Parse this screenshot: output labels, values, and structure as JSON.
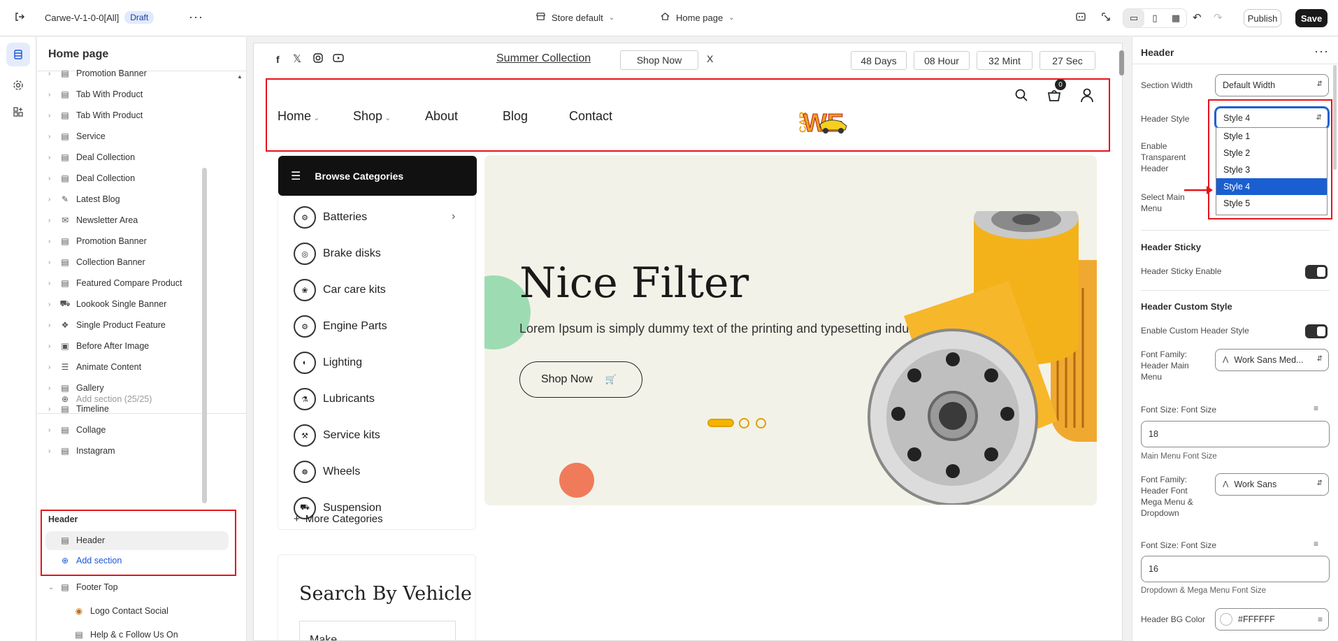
{
  "topbar": {
    "theme_name": "Carwe-V-1-0-0[All]",
    "status_badge": "Draft",
    "store_label": "Store default",
    "page_label": "Home page",
    "publish_label": "Publish",
    "save_label": "Save"
  },
  "sidebar": {
    "title": "Home page",
    "items": [
      {
        "label": "Promotion Banner",
        "icon": "section-icon"
      },
      {
        "label": "Tab With Product",
        "icon": "section-icon"
      },
      {
        "label": "Tab With Product",
        "icon": "section-icon"
      },
      {
        "label": "Service",
        "icon": "section-icon"
      },
      {
        "label": "Deal Collection",
        "icon": "section-icon"
      },
      {
        "label": "Deal Collection",
        "icon": "section-icon"
      },
      {
        "label": "Latest Blog",
        "icon": "blog-icon"
      },
      {
        "label": "Newsletter Area",
        "icon": "mail-icon"
      },
      {
        "label": "Promotion Banner",
        "icon": "section-icon"
      },
      {
        "label": "Collection Banner",
        "icon": "section-icon"
      },
      {
        "label": "Featured Compare Product",
        "icon": "section-icon"
      },
      {
        "label": "Lookook Single Banner",
        "icon": "truck-icon"
      },
      {
        "label": "Single Product Feature",
        "icon": "product-icon"
      },
      {
        "label": "Before After Image",
        "icon": "image-icon"
      },
      {
        "label": "Animate Content",
        "icon": "text-icon"
      },
      {
        "label": "Gallery",
        "icon": "section-icon"
      },
      {
        "label": "Timeline",
        "icon": "section-icon"
      },
      {
        "label": "Collage",
        "icon": "section-icon"
      },
      {
        "label": "Instagram",
        "icon": "section-icon"
      }
    ],
    "add_section_disabled": "Add section (25/25)",
    "header_group": {
      "title": "Header",
      "item": "Header",
      "add_section": "Add section"
    },
    "footer_top": "Footer Top",
    "logo_contact": "Logo Contact Social",
    "cut_row": "Help & c Follow Us On"
  },
  "preview": {
    "announcement": {
      "link": "Summer Collection",
      "shop_now": "Shop Now",
      "close": "X",
      "countdown": [
        "48 Days",
        "08 Hour",
        "32 Mint",
        "27 Sec"
      ]
    },
    "nav": [
      "Home",
      "Shop",
      "About",
      "Blog",
      "Contact"
    ],
    "logo_text": "CAR WE",
    "cart_count": "0",
    "browse_label": "Browse Categories",
    "categories": [
      "Batteries",
      "Brake disks",
      "Car care kits",
      "Engine Parts",
      "Lighting",
      "Lubricants",
      "Service kits",
      "Wheels",
      "Suspension"
    ],
    "more_categories": "More Categories",
    "hero": {
      "title": "Nice Filter",
      "subtitle": "Lorem Ipsum is simply dummy text of the printing and typesetting industry.",
      "button": "Shop Now"
    },
    "search_title": "Search By Vehicle",
    "make_label": "Make"
  },
  "settings": {
    "title": "Header",
    "section_width_label": "Section Width",
    "section_width_value": "Default Width",
    "header_style_label": "Header Style",
    "header_style_value": "Style 4",
    "style_options": [
      "Style 1",
      "Style 2",
      "Style 3",
      "Style 4",
      "Style 5"
    ],
    "transparent_label": "Enable Transparent Header",
    "main_menu_label": "Select Main Menu",
    "sticky_title": "Header Sticky",
    "sticky_enable_label": "Header Sticky Enable",
    "custom_title": "Header Custom Style",
    "custom_enable_label": "Enable Custom Header Style",
    "font_family_main_label": "Font Family: Header Main Menu",
    "font_family_main_value": "Work Sans Med...",
    "font_size_label_1": "Font Size: Font Size",
    "font_size_value_1": "18",
    "font_size_help_1": "Main Menu Font Size",
    "font_family_mega_label": "Font Family: Header Font Mega Menu & Dropdown",
    "font_family_mega_value": "Work Sans",
    "font_size_label_2": "Font Size: Font Size",
    "font_size_value_2": "16",
    "font_size_help_2": "Dropdown & Mega Menu Font Size",
    "bg_color_label": "Header BG Color",
    "bg_color_value": "#FFFFFF"
  },
  "colors": {
    "accent_blue": "#1a5fd1",
    "highlight_red": "#e5141b",
    "hero_bg": "#f3f2e8",
    "slider_yellow": "#f4b400"
  }
}
